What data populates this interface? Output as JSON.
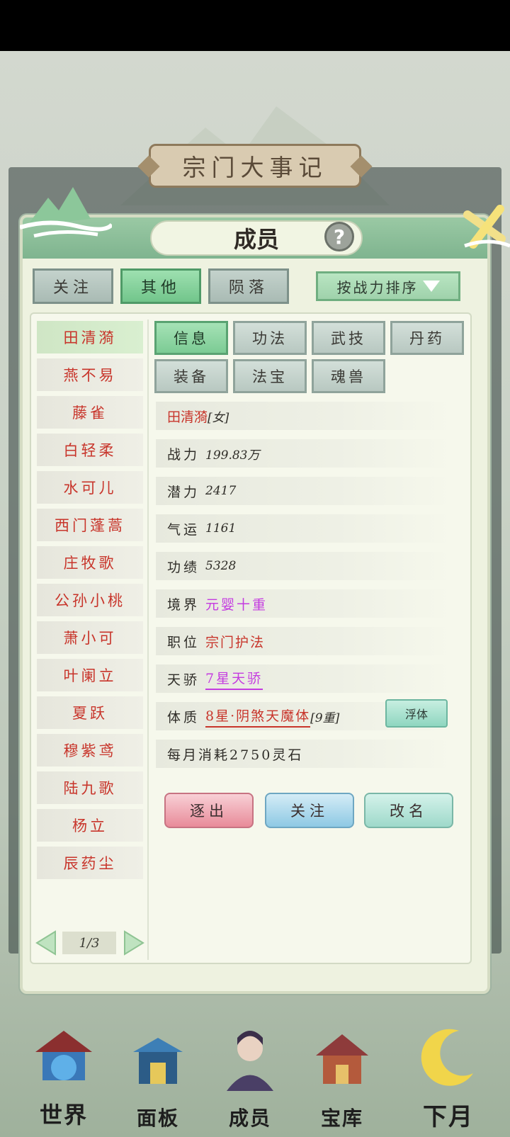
{
  "background": {
    "event_title": "宗门大事记"
  },
  "dialog": {
    "title": "成员",
    "help_symbol": "?"
  },
  "filter_tabs": [
    {
      "label": "关注",
      "active": false
    },
    {
      "label": "其他",
      "active": true
    },
    {
      "label": "陨落",
      "active": false
    }
  ],
  "sort": {
    "label": "按战力排序"
  },
  "members": [
    {
      "name": "田清漪",
      "active": true
    },
    {
      "name": "燕不易"
    },
    {
      "name": "藤雀"
    },
    {
      "name": "白轻柔"
    },
    {
      "name": "水可儿"
    },
    {
      "name": "西门蓬蒿"
    },
    {
      "name": "庄牧歌"
    },
    {
      "name": "公孙小桃"
    },
    {
      "name": "萧小可"
    },
    {
      "name": "叶阑立"
    },
    {
      "name": "夏跃"
    },
    {
      "name": "穆紫鸢"
    },
    {
      "name": "陆九歌"
    },
    {
      "name": "杨立"
    },
    {
      "name": "辰药尘"
    }
  ],
  "pagination": {
    "page": "1/3"
  },
  "detail_tabs": [
    {
      "label": "信息",
      "active": true
    },
    {
      "label": "功法"
    },
    {
      "label": "武技"
    },
    {
      "label": "丹药"
    },
    {
      "label": "装备"
    },
    {
      "label": "法宝"
    },
    {
      "label": "魂兽"
    }
  ],
  "info": {
    "name": "田清漪",
    "gender": "[女]",
    "power_label": "战力",
    "power_value": "199.83万",
    "potential_label": "潜力",
    "potential_value": "2417",
    "luck_label": "气运",
    "luck_value": "1161",
    "merit_label": "功绩",
    "merit_value": "5328",
    "realm_label": "境界",
    "realm_value": "元婴十重",
    "position_label": "职位",
    "position_value": "宗门护法",
    "talent_label": "天骄",
    "talent_value": "7星天骄",
    "physique_label": "体质",
    "physique_value": "8星·阴煞天魔体",
    "physique_level": "[9重]",
    "float_button": "浮体",
    "cost": "每月消耗2750灵石"
  },
  "actions": {
    "expel": "逐出",
    "follow": "关注",
    "rename": "改名"
  },
  "bottom_nav": [
    {
      "label": "世界"
    },
    {
      "label": "面板"
    },
    {
      "label": "成员"
    },
    {
      "label": "宝库"
    },
    {
      "label": "下月"
    }
  ],
  "colors": {
    "name_red": "#c8352b",
    "realm_purple": "#c43be0",
    "active_green": "#7fc894"
  }
}
